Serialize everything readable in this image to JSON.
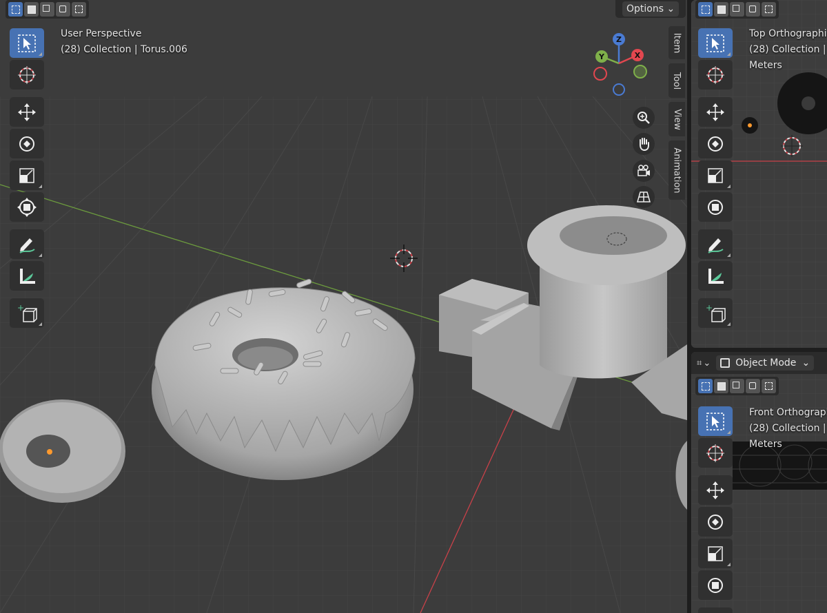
{
  "main_viewport": {
    "view_name": "User Perspective",
    "collection_info": "(28) Collection | Torus.006",
    "options_label": "Options",
    "npanel_tabs": [
      "Item",
      "Tool",
      "View",
      "Animation"
    ],
    "gizmo": {
      "z": "Z",
      "y": "Y",
      "x": "X"
    }
  },
  "top_viewport": {
    "view_name": "Top Orthographic",
    "collection_info": "(28) Collection |",
    "units": "Meters"
  },
  "front_viewport": {
    "mode_label": "Object Mode",
    "view_name": "Front Orthograph",
    "collection_info": "(28) Collection |",
    "units": "Meters"
  },
  "tools": [
    "select-box",
    "cursor",
    "move",
    "rotate",
    "scale",
    "transform",
    "annotate",
    "measure",
    "add-cube"
  ],
  "colors": {
    "active_tool": "#4772b3",
    "axis_x": "#e2474f",
    "axis_y": "#7fb04a",
    "axis_z": "#4a7bd3",
    "viewport_bg": "#3c3c3c",
    "panel_bg": "#2b2b2b"
  }
}
